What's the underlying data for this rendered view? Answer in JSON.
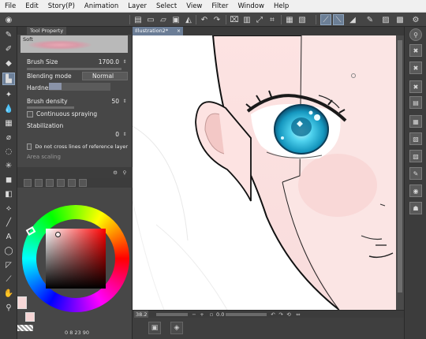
{
  "menu": [
    "File",
    "Edit",
    "Story(P)",
    "Animation",
    "Layer",
    "Select",
    "View",
    "Filter",
    "Window",
    "Help"
  ],
  "tool_property": {
    "tab_title": "Tool Property",
    "brush_name": "Soft",
    "brush_size_label": "Brush Size",
    "brush_size_value": "1700.0",
    "blending_mode_label": "Blending mode",
    "blending_mode_value": "Normal",
    "hardness_label": "Hardness",
    "brush_density_label": "Brush density",
    "brush_density_value": "50",
    "continuous_spraying_label": "Continuous spraying",
    "stabilization_label": "Stabilization",
    "stabilization_value": "0",
    "do_not_cross_label": "Do not cross lines of reference layer",
    "area_scaling_label": "Area scaling"
  },
  "document": {
    "tab_title": "Illustration2*"
  },
  "canvas_status": {
    "zoom": "38.2",
    "angle": "0.0"
  },
  "color_panel": {
    "status": "0  8  23  90",
    "main_color": "#f7d8d8",
    "sub_color": "#f5d4d4"
  },
  "icons": {
    "close": "×",
    "spin": "⇕"
  }
}
